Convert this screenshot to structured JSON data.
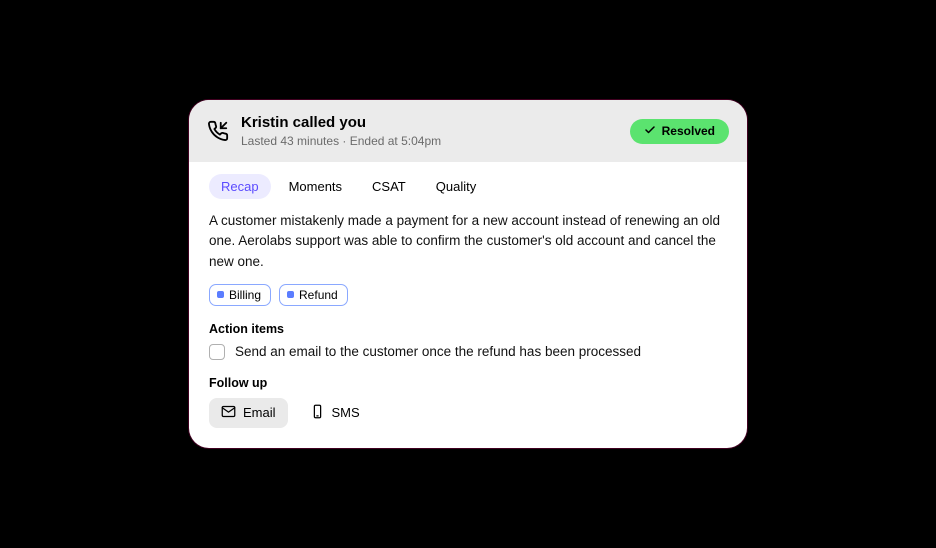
{
  "header": {
    "title": "Kristin called you",
    "subtitle": "Lasted 43 minutes · Ended at 5:04pm",
    "status_label": "Resolved"
  },
  "tabs": [
    {
      "label": "Recap",
      "active": true
    },
    {
      "label": "Moments",
      "active": false
    },
    {
      "label": "CSAT",
      "active": false
    },
    {
      "label": "Quality",
      "active": false
    }
  ],
  "recap": {
    "text": "A customer mistakenly made a payment for a new account instead of renewing an old one. Aerolabs support was able to confirm the customer's old account and cancel the new one.",
    "tags": [
      {
        "label": "Billing"
      },
      {
        "label": "Refund"
      }
    ]
  },
  "action_items": {
    "heading": "Action items",
    "items": [
      {
        "text": "Send an email to the customer once the refund has been processed",
        "checked": false
      }
    ]
  },
  "follow_up": {
    "heading": "Follow up",
    "options": [
      {
        "label": "Email",
        "icon": "envelope-icon",
        "selected": true
      },
      {
        "label": "SMS",
        "icon": "device-icon",
        "selected": false
      }
    ]
  }
}
